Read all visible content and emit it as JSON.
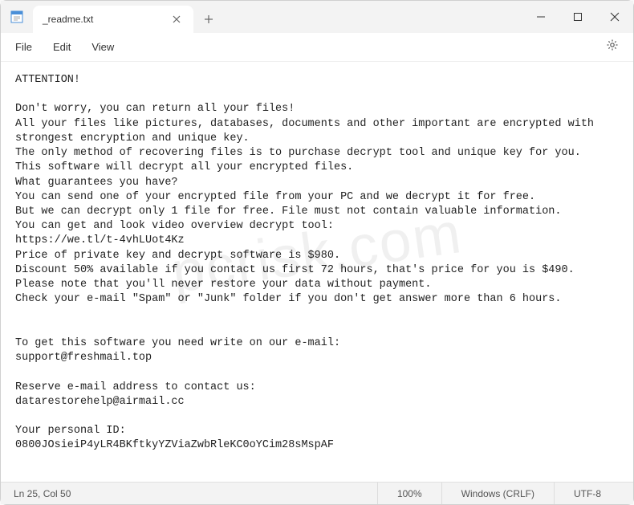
{
  "tab": {
    "title": "_readme.txt"
  },
  "menubar": {
    "file": "File",
    "edit": "Edit",
    "view": "View"
  },
  "content": {
    "text": "ATTENTION!\n\nDon't worry, you can return all your files!\nAll your files like pictures, databases, documents and other important are encrypted with strongest encryption and unique key.\nThe only method of recovering files is to purchase decrypt tool and unique key for you.\nThis software will decrypt all your encrypted files.\nWhat guarantees you have?\nYou can send one of your encrypted file from your PC and we decrypt it for free.\nBut we can decrypt only 1 file for free. File must not contain valuable information.\nYou can get and look video overview decrypt tool:\nhttps://we.tl/t-4vhLUot4Kz\nPrice of private key and decrypt software is $980.\nDiscount 50% available if you contact us first 72 hours, that's price for you is $490.\nPlease note that you'll never restore your data without payment.\nCheck your e-mail \"Spam\" or \"Junk\" folder if you don't get answer more than 6 hours.\n\n\nTo get this software you need write on our e-mail:\nsupport@freshmail.top\n\nReserve e-mail address to contact us:\ndatarestorehelp@airmail.cc\n\nYour personal ID:\n0800JOsieiP4yLR4BKftkyYZViaZwbRleKC0oYCim28sMspAF"
  },
  "statusbar": {
    "position": "Ln 25, Col 50",
    "zoom": "100%",
    "eol": "Windows (CRLF)",
    "encoding": "UTF-8"
  },
  "watermark": "pcrisk.com"
}
